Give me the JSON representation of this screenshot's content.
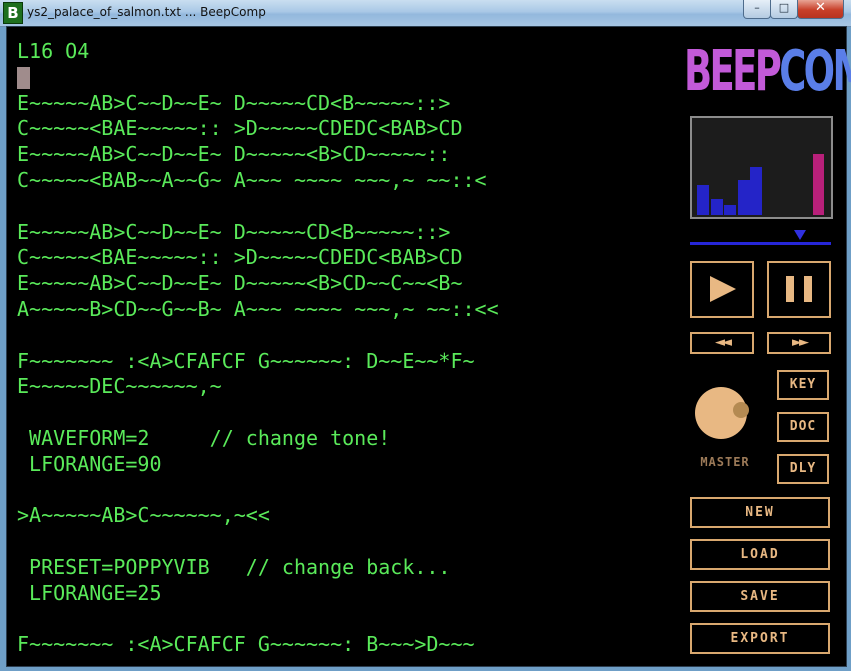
{
  "window": {
    "title": "ys2_palace_of_salmon.txt ... BeepComp",
    "app_icon_letter": "B",
    "minimize_glyph": "–",
    "maximize_glyph": "□",
    "close_glyph": "✕"
  },
  "editor": {
    "lines": [
      "L16 O4",
      "",
      "E~~~~~AB>C~~D~~E~ D~~~~~CD<B~~~~~::>",
      "C~~~~~<BAE~~~~~:: >D~~~~~CDEDC<BAB>CD",
      "E~~~~~AB>C~~D~~E~ D~~~~~<B>CD~~~~~::",
      "C~~~~~<BAB~~A~~G~ A~~~ ~~~~ ~~~,~ ~~::<",
      "",
      "E~~~~~AB>C~~D~~E~ D~~~~~CD<B~~~~~::>",
      "C~~~~~<BAE~~~~~:: >D~~~~~CDEDC<BAB>CD",
      "E~~~~~AB>C~~D~~E~ D~~~~~<B>CD~~C~~<B~",
      "A~~~~~B>CD~~G~~B~ A~~~ ~~~~ ~~~,~ ~~::<<",
      "",
      "F~~~~~~~ :<A>CFAFCF G~~~~~~: D~~E~~*F~",
      "E~~~~~DEC~~~~~~,~",
      "",
      " WAVEFORM=2     // change tone!",
      " LFORANGE=90",
      "",
      ">A~~~~~AB>C~~~~~~,~<<",
      "",
      " PRESET=POPPYVIB   // change back...",
      " LFORANGE=25",
      "",
      "F~~~~~~~ :<A>CFAFCF G~~~~~~: B~~~>D~~~"
    ]
  },
  "logo": {
    "part1": "BEEP",
    "part2": "COMP",
    "color1": "#c25ad8",
    "color2": "#5a7ee8"
  },
  "scope": {
    "bars": [
      {
        "level": 0.32,
        "color": "#2424c8"
      },
      {
        "level": 0.17,
        "color": "#2424c8"
      },
      {
        "level": 0.11,
        "color": "#2424c8"
      },
      {
        "level": 0.37,
        "color": "#2424c8"
      },
      {
        "level": 0.51,
        "color": "#2424c8"
      },
      {
        "level": 0.64,
        "color": "#b8207a"
      }
    ]
  },
  "volume": {
    "level": 0.78
  },
  "transport": {
    "rewind_glyph": "◄◄",
    "forward_glyph": "►►"
  },
  "master_label": "MASTER",
  "buttons": {
    "key": "KEY",
    "doc": "DOC",
    "dly": "DLY",
    "new": "NEW",
    "load": "LOAD",
    "save": "SAVE",
    "export": "EXPORT"
  },
  "colors": {
    "accent": "#d9a86f",
    "text": "#5aea5a",
    "background": "#000000"
  }
}
